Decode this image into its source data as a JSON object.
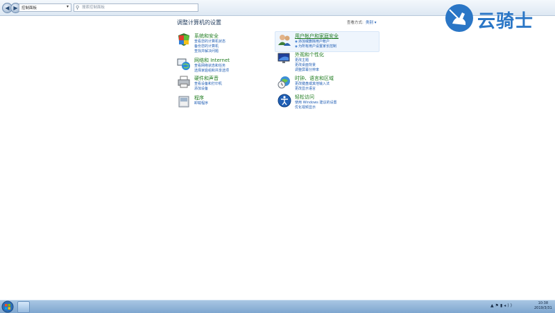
{
  "address_bar": {
    "path": "控制面板",
    "search_placeholder": "搜索控制面板"
  },
  "header": {
    "title": "调整计算机的设置",
    "view_by_label": "查看方式:",
    "view_by_value": "类别 ▾"
  },
  "logo": {
    "text": "云骑士"
  },
  "categories": [
    {
      "title": "系统和安全",
      "links": [
        "查看您的计算机状态",
        "备份您的计算机",
        "查找并解决问题"
      ]
    },
    {
      "title": "网络和 Internet",
      "links": [
        "查看网络状态和任务",
        "选择家庭组和共享选项"
      ]
    },
    {
      "title": "硬件和声音",
      "links": [
        "查看设备和打印机",
        "添加设备"
      ]
    },
    {
      "title": "程序",
      "links": [
        "卸载程序"
      ]
    },
    {
      "title": "用户帐户和家庭安全",
      "links": [
        "添加或删除用户帐户",
        "为所有用户设置家长控制"
      ]
    },
    {
      "title": "外观和个性化",
      "links": [
        "更改主题",
        "更改桌面背景",
        "调整屏幕分辨率"
      ]
    },
    {
      "title": "时钟、语言和区域",
      "links": [
        "更改键盘或其他输入法",
        "更改显示语言"
      ]
    },
    {
      "title": "轻松访问",
      "links": [
        "使用 Windows 建议的设置",
        "优化视频显示"
      ]
    }
  ],
  "taskbar": {
    "time": "10:38",
    "date": "2019/3/31"
  }
}
